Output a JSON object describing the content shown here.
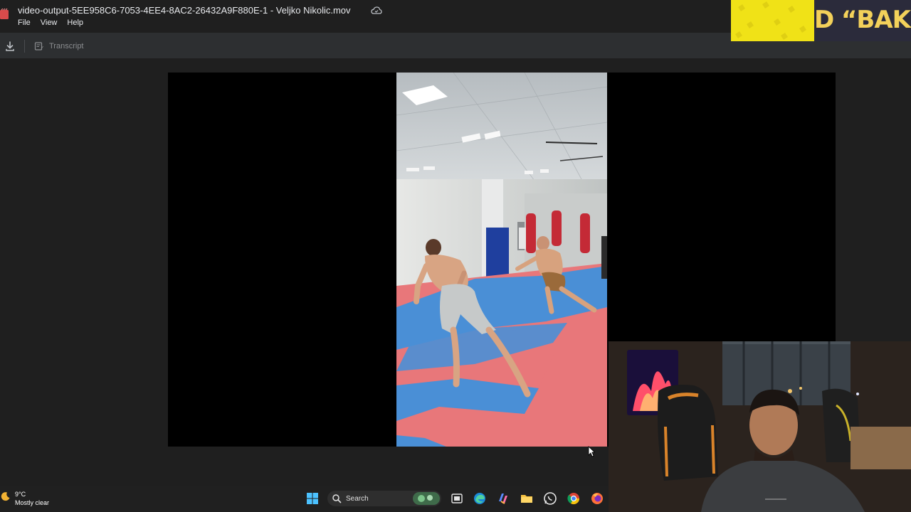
{
  "window": {
    "title": "video-output-5EE958C6-7053-4EE4-8AC2-26432A9F880E-1 - Veljko Nikolic.mov"
  },
  "menu": {
    "items": [
      {
        "label": "File"
      },
      {
        "label": "View"
      },
      {
        "label": "Help"
      }
    ]
  },
  "toolbar": {
    "transcript_label": "Transcript",
    "download_icon": "download-icon"
  },
  "overlay": {
    "banner_text": "D “BAKA”"
  },
  "taskbar": {
    "weather_temp": "9°C",
    "weather_condition": "Mostly clear",
    "search_label": "Search"
  },
  "colors": {
    "background": "#1f1f1f",
    "toolbar": "#2d2f31",
    "banner_yellow": "#f0e217",
    "banner_text": "#f3d15a",
    "mat_red": "#e8777a",
    "mat_blue": "#4a8fd6"
  }
}
